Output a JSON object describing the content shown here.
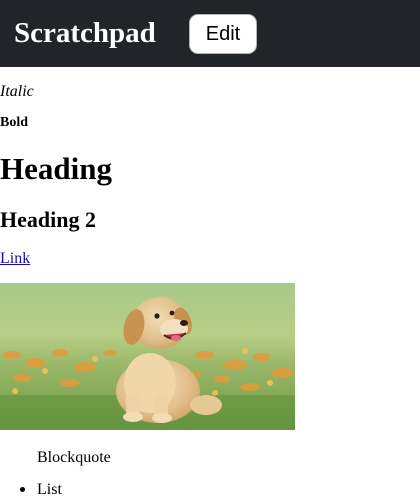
{
  "header": {
    "title": "Scratchpad",
    "edit_label": "Edit",
    "background": "#212529"
  },
  "content": {
    "italic": "Italic",
    "bold": "Bold",
    "heading1": "Heading",
    "heading2": "Heading 2",
    "link": "Link",
    "image_icon": "puppy-photo",
    "blockquote": "Blockquote",
    "list_items": [
      "List"
    ]
  },
  "colors": {
    "link": "#1a0dab",
    "page_background": "#ffffff"
  }
}
